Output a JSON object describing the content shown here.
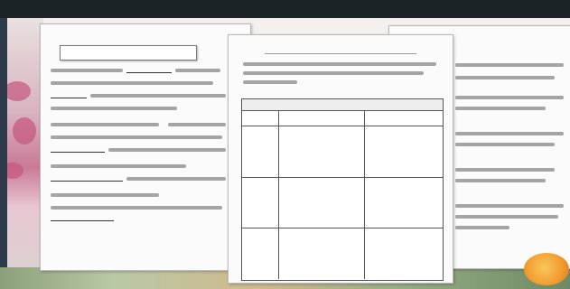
{
  "banner": {
    "text": ""
  },
  "left_sheet": {
    "title": "",
    "name_box": "",
    "footer_labels": [
      "",
      "",
      ""
    ]
  },
  "center_sheet": {
    "title": "",
    "table": {
      "caption": "",
      "columns": [
        "",
        "",
        ""
      ],
      "rows": [
        "",
        "",
        ""
      ]
    }
  },
  "right_sheet": {
    "title": ""
  },
  "colors": {
    "banner": "#1c2326",
    "sheet": "#fbfbfb",
    "sticker": "#f29a2e",
    "blossom": "#c5567e"
  }
}
